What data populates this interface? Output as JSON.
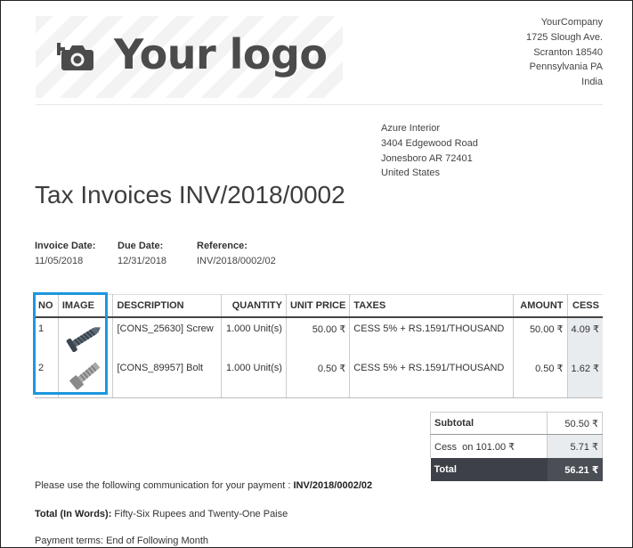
{
  "colors": {
    "accent_highlight": "#1d97de",
    "total_bg": "#3d4147",
    "cess_bg": "#e9ecef"
  },
  "logo": {
    "text": "Your logo",
    "icon": "camera-plus-icon"
  },
  "company": {
    "lines": [
      "YourCompany",
      "1725 Slough Ave.",
      "Scranton 18540",
      "Pennsylvania PA",
      "India"
    ]
  },
  "customer": {
    "lines": [
      "Azure Interior",
      "3404 Edgewood Road",
      "Jonesboro AR 72401",
      "United States"
    ]
  },
  "document": {
    "title": "Tax Invoices INV/2018/0002"
  },
  "info": {
    "invoice_date_label": "Invoice Date:",
    "invoice_date": "11/05/2018",
    "due_date_label": "Due Date:",
    "due_date": "12/31/2018",
    "reference_label": "Reference:",
    "reference": "INV/2018/0002/02"
  },
  "lines_table": {
    "headers": [
      "NO",
      "IMAGE",
      "DESCRIPTION",
      "QUANTITY",
      "UNIT PRICE",
      "TAXES",
      "AMOUNT",
      "CESS"
    ],
    "rows": [
      {
        "no": "1",
        "image": "screw-icon",
        "description": "[CONS_25630] Screw",
        "quantity": "1.000 Unit(s)",
        "unit_price": "50.00 ₹",
        "taxes": "CESS 5% + RS.1591/THOUSAND",
        "amount": "50.00 ₹",
        "cess": "4.09 ₹"
      },
      {
        "no": "2",
        "image": "bolt-icon",
        "description": "[CONS_89957] Bolt",
        "quantity": "1.000 Unit(s)",
        "unit_price": "0.50 ₹",
        "taxes": "CESS 5% + RS.1591/THOUSAND",
        "amount": "0.50 ₹",
        "cess": "1.62 ₹"
      }
    ]
  },
  "totals": {
    "subtotal_label": "Subtotal",
    "subtotal": "50.50 ₹",
    "cess_label": "Cess  on 101.00 ₹",
    "cess": "5.71 ₹",
    "total_label": "Total",
    "total": "56.21 ₹"
  },
  "footer": {
    "communication_text": "Please use the following communication for your payment : ",
    "communication_ref": "INV/2018/0002/02",
    "words_label": "Total (In Words):",
    "words_value": " Fifty-Six Rupees and Twenty-One Paise",
    "payment_terms": "Payment terms: End of Following Month"
  }
}
